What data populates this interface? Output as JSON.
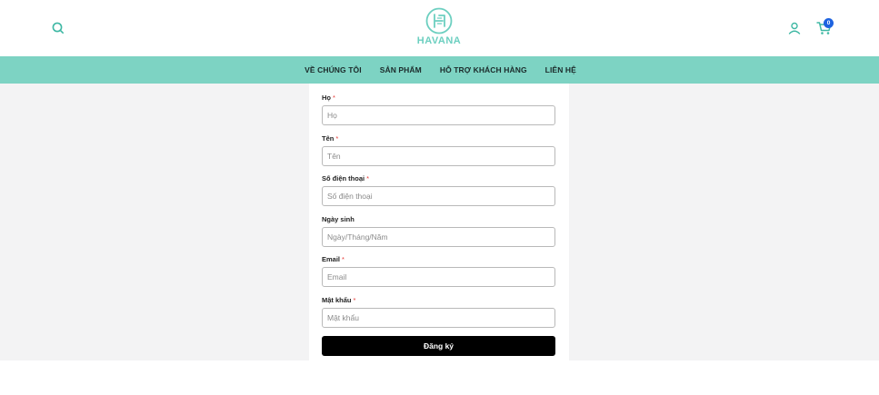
{
  "header": {
    "logo_text": "HAVANA",
    "cart_count": "0",
    "icons": [
      "search-icon",
      "user-icon",
      "cart-icon"
    ],
    "brand_color": "#6ccfc0"
  },
  "nav": {
    "items": [
      "VỀ CHÚNG TÔI",
      "SẢN PHẨM",
      "HỖ TRỢ KHÁCH HÀNG",
      "LIÊN HỆ"
    ],
    "background": "#7dd3c3"
  },
  "form": {
    "fields": [
      {
        "label": "Họ",
        "required": "*",
        "placeholder": "Họ",
        "value": ""
      },
      {
        "label": "Tên",
        "required": "*",
        "placeholder": "Tên",
        "value": ""
      },
      {
        "label": "Số điện thoại",
        "required": "*",
        "placeholder": "Số điện thoại",
        "value": ""
      },
      {
        "label": "Ngày sinh",
        "required": "",
        "placeholder": "Ngày/Tháng/Năm",
        "value": ""
      },
      {
        "label": "Email",
        "required": "*",
        "placeholder": "Email",
        "value": ""
      },
      {
        "label": "Mật khẩu",
        "required": "*",
        "placeholder": "Mật khẩu",
        "value": ""
      }
    ],
    "submit_label": "Đăng ký",
    "required_color": "#e53935"
  }
}
